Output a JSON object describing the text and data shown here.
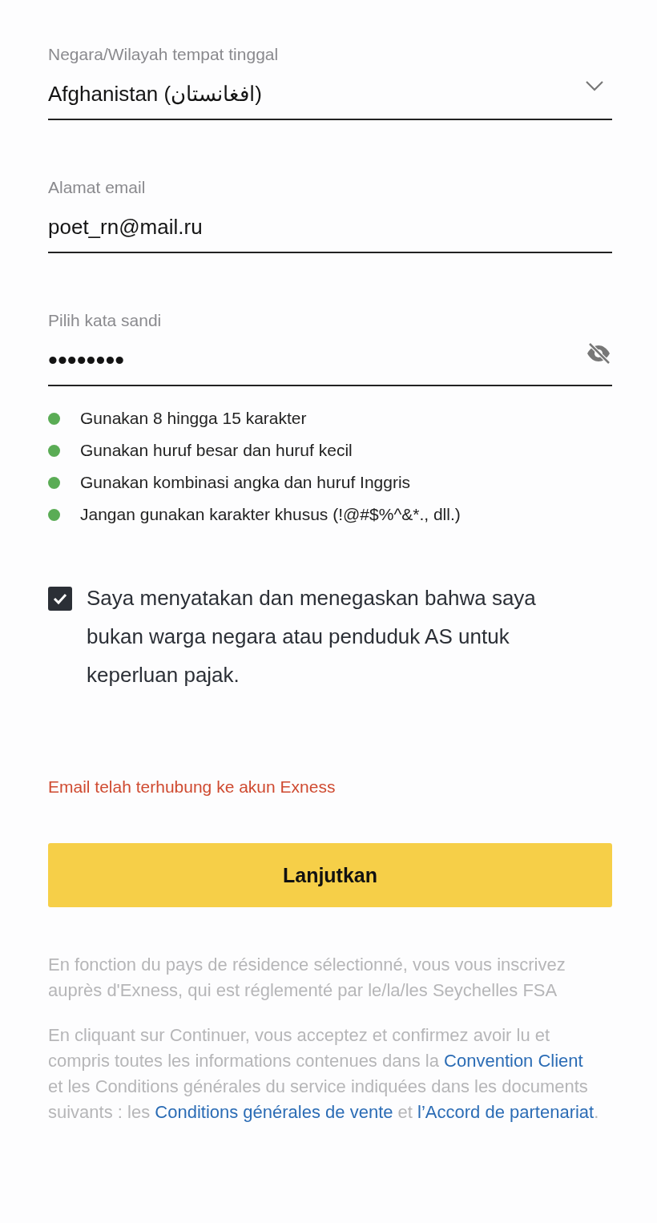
{
  "fields": [
    {
      "kind": "select",
      "label": "Negara/Wilayah tempat tinggal",
      "value": "Afghanistan (افغانستان)"
    },
    {
      "kind": "text",
      "label": "Alamat email",
      "value": "poet_rn@mail.ru"
    },
    {
      "kind": "password",
      "label": "Pilih kata sandi",
      "value": "••••••••"
    }
  ],
  "requirements": [
    {
      "text": "Gunakan 8 hingga 15 karakter",
      "met": true
    },
    {
      "text": "Gunakan huruf besar dan huruf kecil",
      "met": true
    },
    {
      "text": "Gunakan kombinasi angka dan huruf Inggris",
      "met": true
    },
    {
      "text": "Jangan gunakan karakter khusus (!@#$%^&*., dll.)",
      "met": true
    }
  ],
  "declaration": {
    "checked": true,
    "text": "Saya menyatakan dan menegaskan bahwa saya bukan warga negara atau penduduk AS untuk keperluan pajak."
  },
  "error": "Email telah terhubung ke akun Exness",
  "submit_button": "Lanjutkan",
  "disclaimers": [
    [
      {
        "kind": "text",
        "text": "En fonction du pays de résidence sélectionné, vous vous inscrivez auprès d'Exness, qui est réglementé par le/la/les Seychelles FSA"
      }
    ],
    [
      {
        "kind": "text",
        "text": "En cliquant sur Continuer, vous acceptez et confirmez avoir lu et compris toutes les informations contenues dans la "
      },
      {
        "kind": "link",
        "text": "Convention Client"
      },
      {
        "kind": "text",
        "text": " et les Conditions générales du service indiquées dans les documents suivants : les "
      },
      {
        "kind": "link",
        "text": "Conditions générales de vente"
      },
      {
        "kind": "text",
        "text": " et "
      },
      {
        "kind": "link",
        "text": "l’Accord de partenariat"
      },
      {
        "kind": "text",
        "text": "."
      }
    ]
  ]
}
